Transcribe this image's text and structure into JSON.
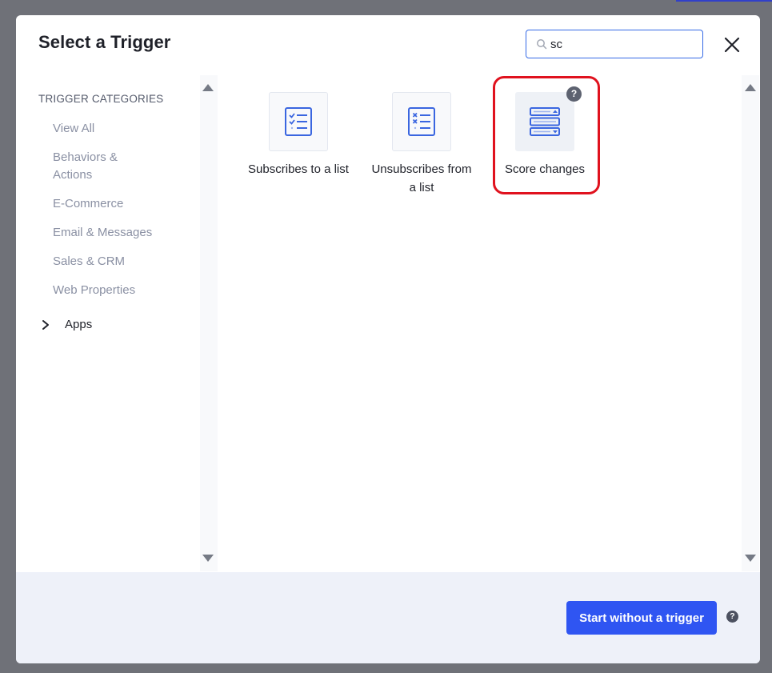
{
  "modal": {
    "title": "Select a Trigger",
    "close_icon": "close-icon"
  },
  "search": {
    "value": "sc",
    "icon": "search-icon"
  },
  "sidebar": {
    "heading": "TRIGGER CATEGORIES",
    "items": [
      {
        "label": "View All"
      },
      {
        "label": "Behaviors & Actions"
      },
      {
        "label": "E-Commerce"
      },
      {
        "label": "Email & Messages"
      },
      {
        "label": "Sales & CRM"
      },
      {
        "label": "Web Properties"
      }
    ],
    "apps": {
      "label": "Apps",
      "icon": "chevron-right-icon"
    }
  },
  "triggers": [
    {
      "label": "Subscribes to a list",
      "icon": "checklist-icon"
    },
    {
      "label": "Unsubscribes from a list",
      "icon": "x-list-icon"
    },
    {
      "label": "Score changes",
      "icon": "score-stack-icon",
      "help": "?"
    }
  ],
  "footer": {
    "start_label": "Start without a trigger",
    "help": "?"
  },
  "colors": {
    "accent": "#2f55f2",
    "icon_blue": "#3a66e0",
    "highlight": "#e0121e",
    "footer_bg": "#eef1f9"
  }
}
